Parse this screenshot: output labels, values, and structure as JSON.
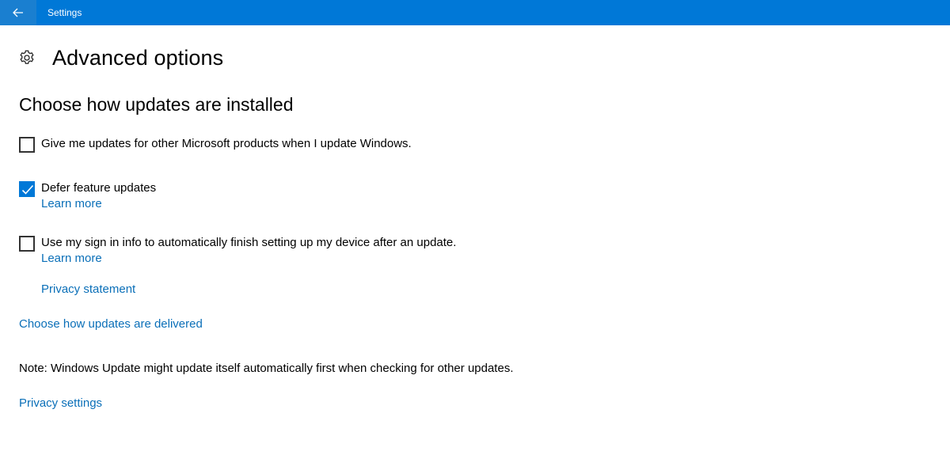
{
  "window": {
    "title": "Settings",
    "accent_color": "#0078d7"
  },
  "header": {
    "icon": "gear-icon",
    "title": "Advanced options"
  },
  "section": {
    "title": "Choose how updates are installed"
  },
  "options": [
    {
      "label": "Give me updates for other Microsoft products when I update Windows.",
      "checked": false
    },
    {
      "label": "Defer feature updates",
      "checked": true,
      "link": "Learn more"
    },
    {
      "label": "Use my sign in info to automatically finish setting up my device after an update.",
      "checked": false,
      "link": "Learn more"
    }
  ],
  "links": {
    "privacy_statement": "Privacy statement",
    "delivery": "Choose how updates are delivered",
    "privacy_settings": "Privacy settings"
  },
  "note": "Note: Windows Update might update itself automatically first when checking for other updates."
}
